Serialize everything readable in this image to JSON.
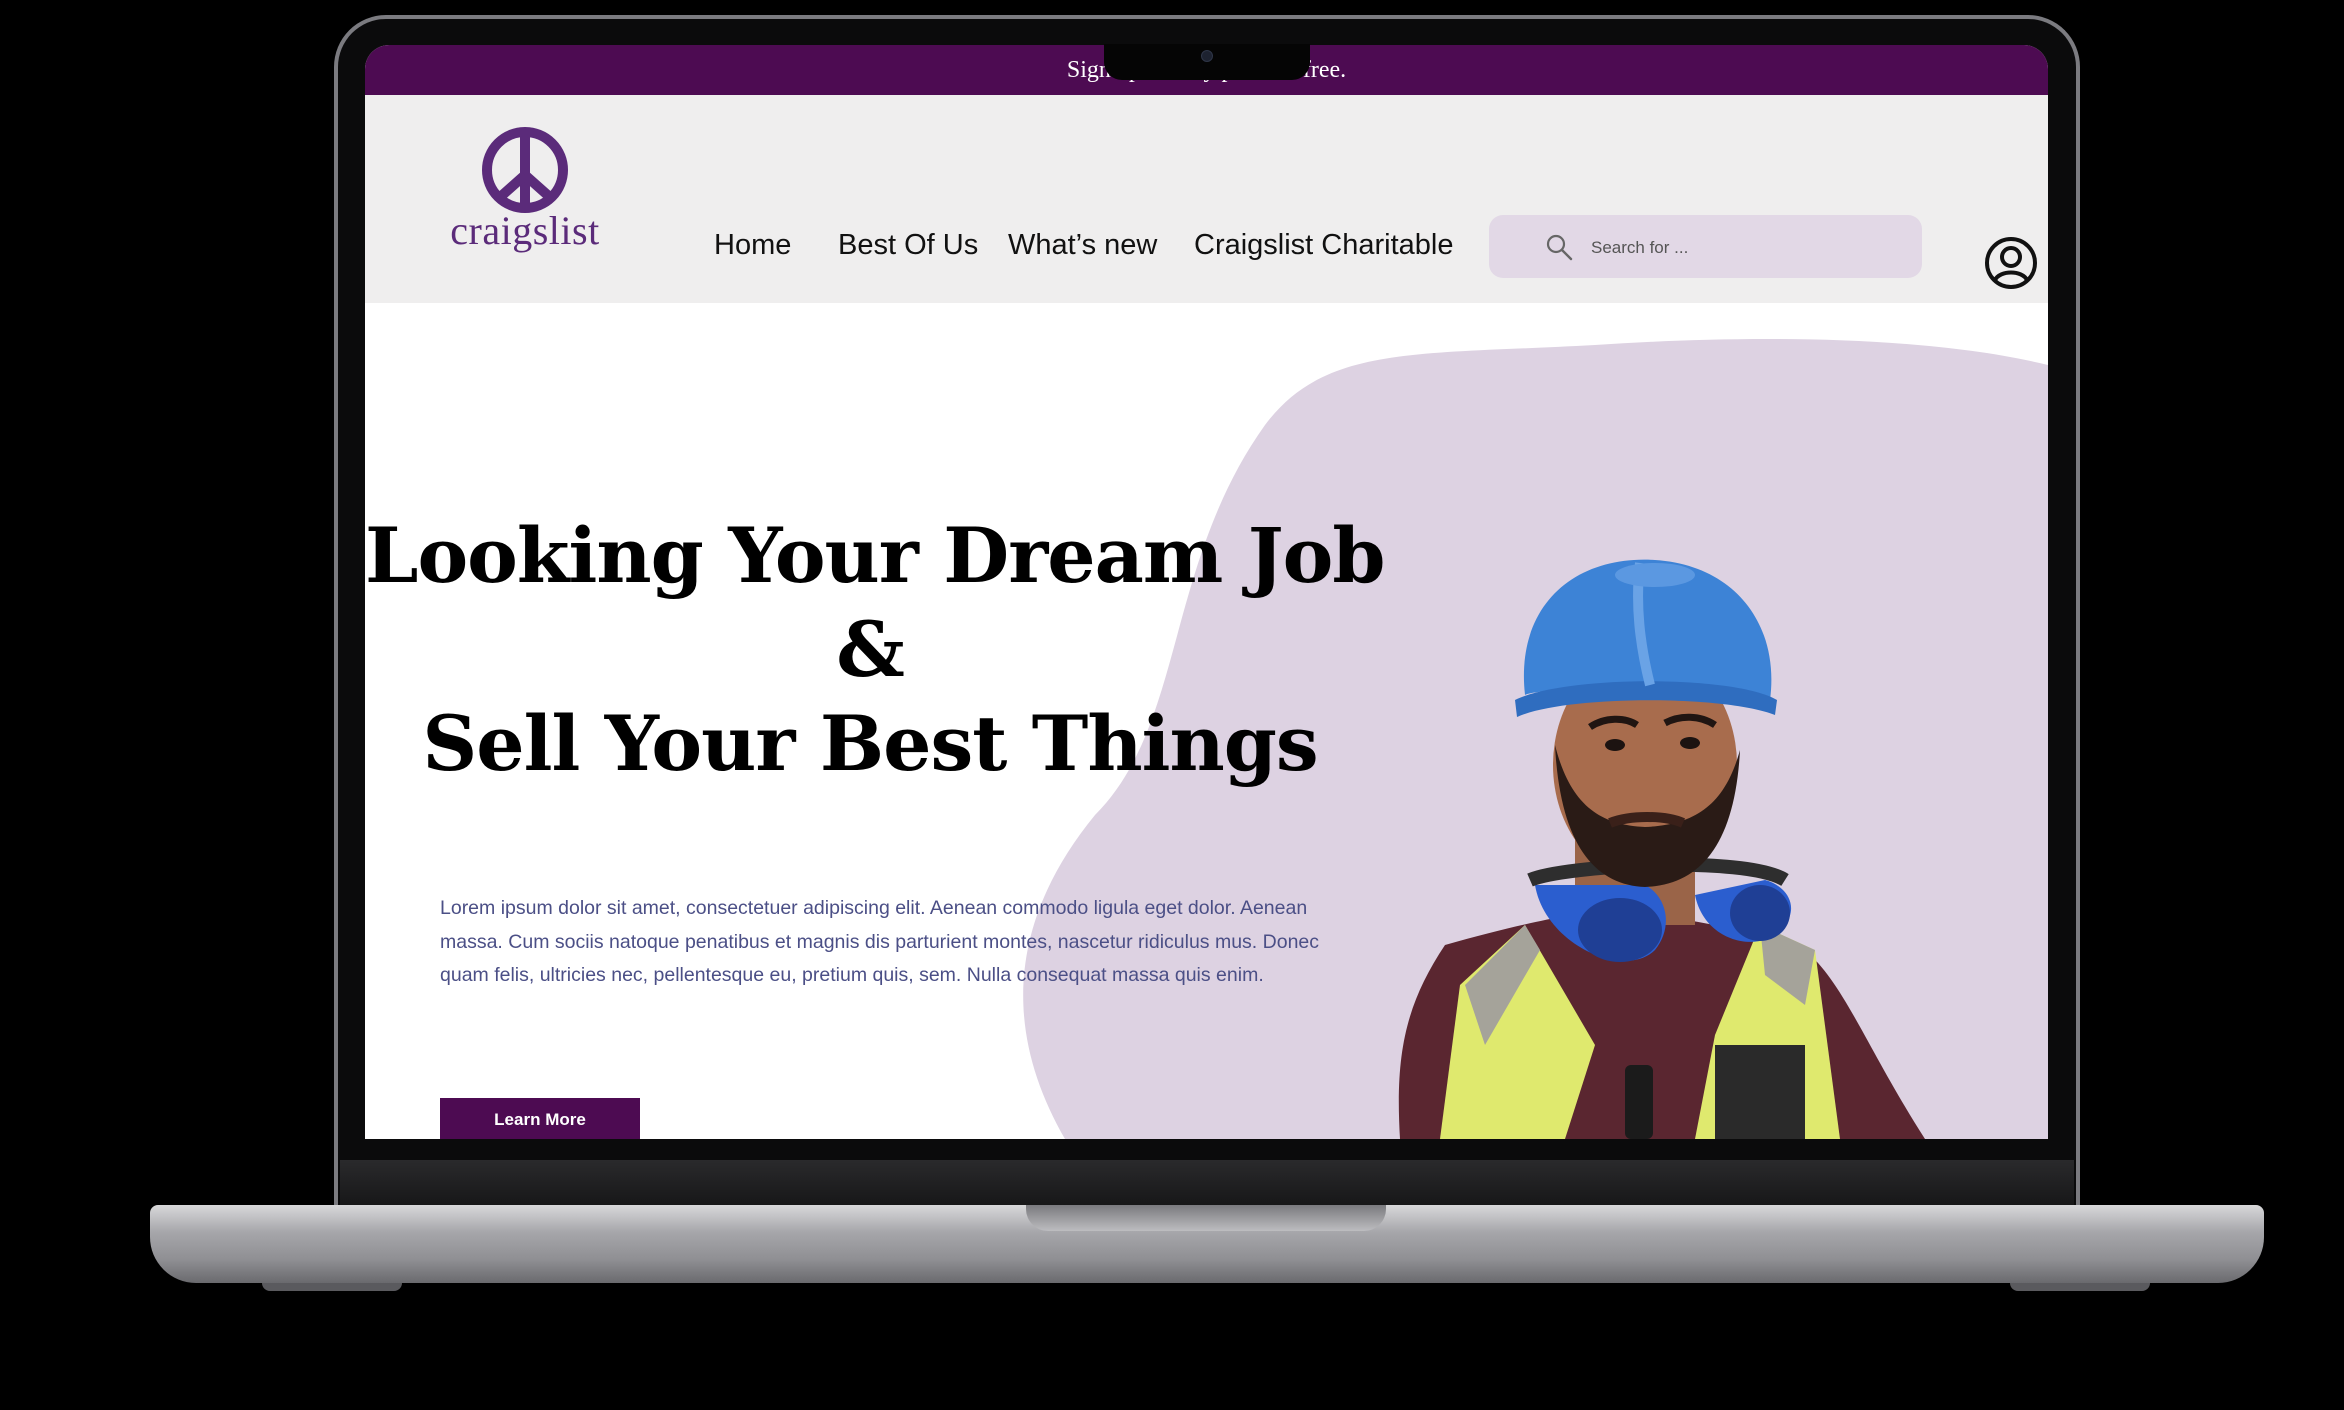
{
  "announcement": {
    "text": "Sign up for any plan for free."
  },
  "brand": {
    "name": "craigslist",
    "color": "#4d0b52",
    "accent": "#5b2b7a",
    "blob_color": "#ddd2e2"
  },
  "nav": {
    "items": [
      {
        "label": "Home"
      },
      {
        "label": "Best Of Us"
      },
      {
        "label": "What’s new"
      },
      {
        "label": "Craigslist Charitable"
      }
    ],
    "search": {
      "placeholder": "Search for ...",
      "icon": "search-icon"
    },
    "account_icon": "user-circle-icon"
  },
  "hero": {
    "headline_line1": "Looking Your Dream Job",
    "headline_amp": "&",
    "headline_line2": "Sell Your Best Things",
    "body": "Lorem ipsum dolor sit amet, consectetuer adipiscing elit. Aenean commodo ligula eget dolor. Aenean massa. Cum sociis natoque penatibus et magnis dis parturient montes, nascetur ridiculus mus. Donec quam felis, ultricies nec, pellentesque eu, pretium quis, sem. Nulla consequat massa quis enim.",
    "cta_label": "Learn More"
  }
}
